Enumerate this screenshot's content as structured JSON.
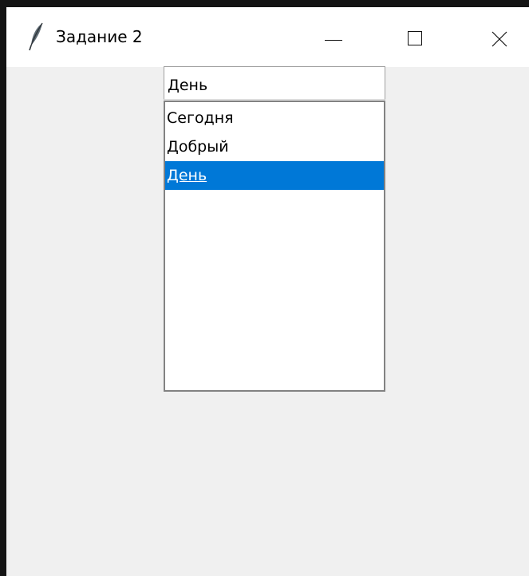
{
  "window": {
    "title": "Задание 2",
    "icon": "tk-feather-icon",
    "controls": [
      "minimize-icon",
      "maximize-icon",
      "close-icon"
    ]
  },
  "entry": {
    "value": "День"
  },
  "listbox": {
    "items": [
      {
        "label": "Сегодня",
        "selected": false
      },
      {
        "label": "Добрый",
        "selected": false
      },
      {
        "label": "День",
        "selected": true
      }
    ],
    "selection_color": "#0078d7"
  }
}
